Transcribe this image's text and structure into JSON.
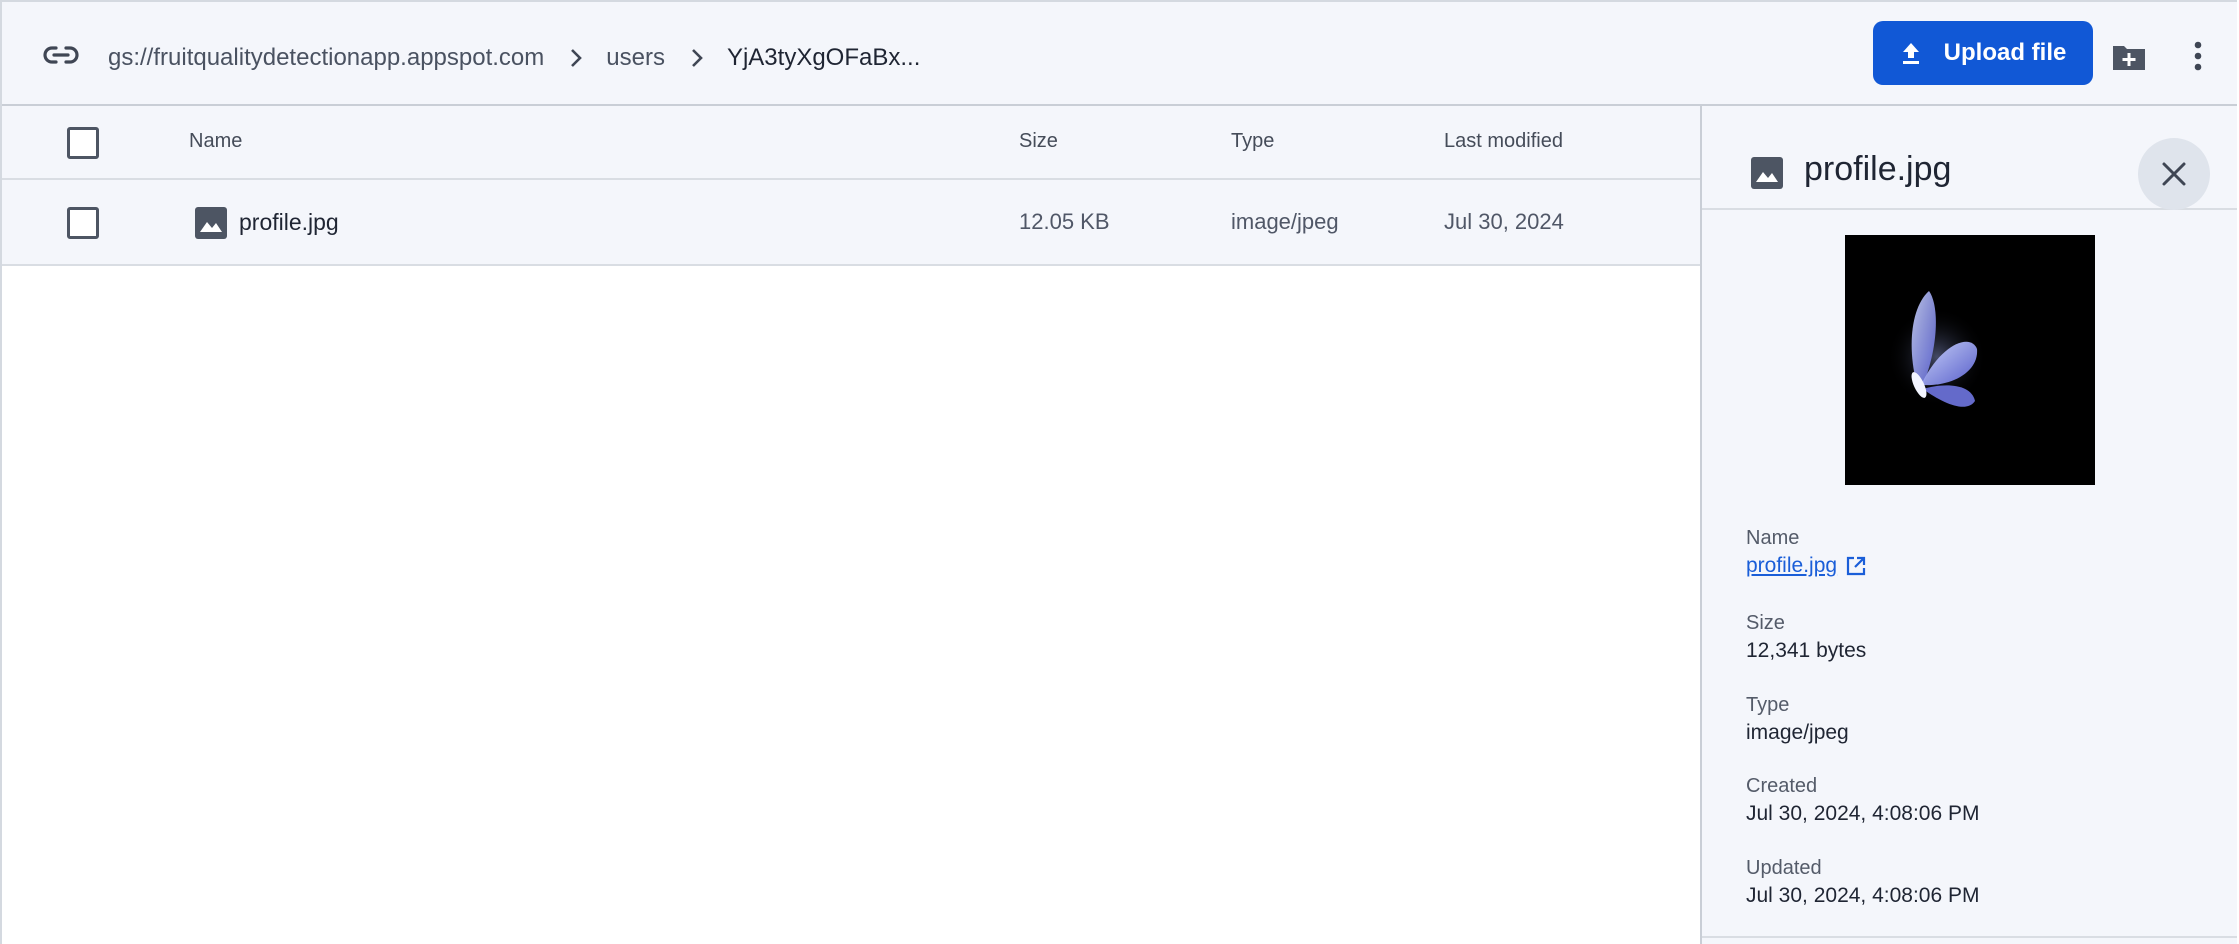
{
  "breadcrumb": {
    "items": [
      {
        "label": "gs://fruitqualitydetectionapp.appspot.com"
      },
      {
        "label": "users"
      },
      {
        "label": "YjA3tyXgOFaBx..."
      }
    ]
  },
  "toolbar": {
    "upload_label": "Upload file",
    "accent": "#1158d6"
  },
  "table": {
    "headers": {
      "name": "Name",
      "size": "Size",
      "type": "Type",
      "modified": "Last modified"
    },
    "rows": [
      {
        "name": "profile.jpg",
        "size": "12.05 KB",
        "type": "image/jpeg",
        "modified": "Jul 30, 2024",
        "icon": "image-icon"
      }
    ]
  },
  "details": {
    "title": "profile.jpg",
    "name_label": "Name",
    "name_value": "profile.jpg",
    "size_label": "Size",
    "size_value": "12,341 bytes",
    "type_label": "Type",
    "type_value": "image/jpeg",
    "created_label": "Created",
    "created_value": "Jul 30, 2024, 4:08:06 PM",
    "updated_label": "Updated",
    "updated_value": "Jul 30, 2024, 4:08:06 PM"
  }
}
